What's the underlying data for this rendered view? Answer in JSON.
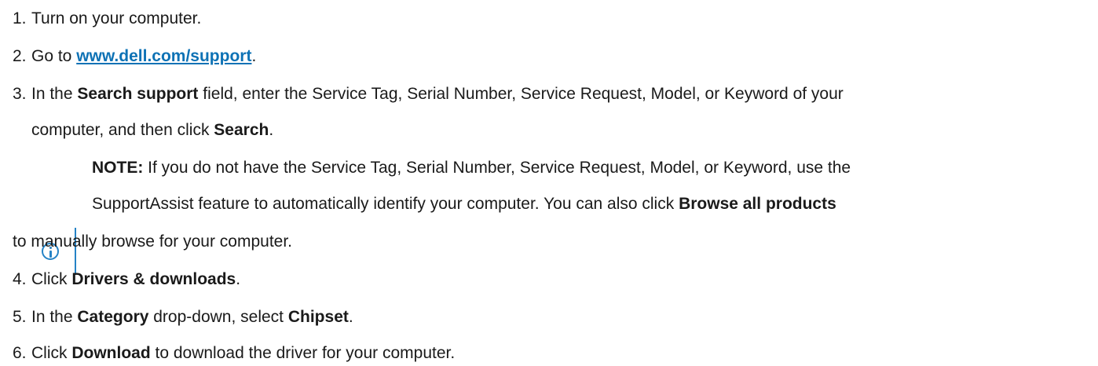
{
  "steps": [
    {
      "num": "1.",
      "text": "Turn on your computer."
    },
    {
      "num": "2.",
      "pre": "Go to ",
      "link": "www.dell.com/support",
      "post": "."
    },
    {
      "num": "3.",
      "pre": "In the ",
      "b1": "Search support",
      "mid": " field, enter the Service Tag, Serial Number, Service Request, Model, or Keyword of your",
      "line2_pre": "computer, and then click ",
      "b2": "Search",
      "line2_post": "."
    },
    {
      "num": "4.",
      "pre": "Click ",
      "b1": "Drivers & downloads",
      "post": "."
    },
    {
      "num": "5.",
      "pre": "In the ",
      "b1": "Category",
      "mid": " drop-down, select ",
      "b2": "Chipset",
      "post": "."
    },
    {
      "num": "6.",
      "pre": "Click ",
      "b1": "Download",
      "post": " to download the driver for your computer."
    }
  ],
  "note": {
    "label": "NOTE:",
    "line1": " If you do not have the Service Tag, Serial Number, Service Request, Model, or Keyword, use the",
    "line2_pre": "SupportAssist feature to automatically identify your computer. You can also click ",
    "line2_bold": "Browse all products",
    "line3": "to manually browse for your computer."
  }
}
